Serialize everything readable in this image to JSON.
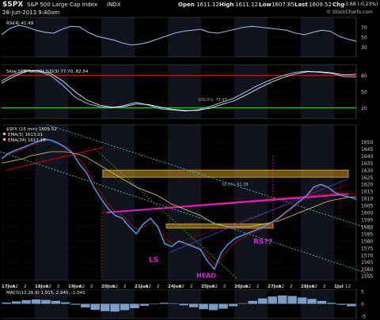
{
  "header": {
    "symbol": "$SPX",
    "name": "S&P 500 Large Cap Index",
    "exchange": "INDX",
    "date": "28-Jun-2013 9:40am",
    "open_label": "Open",
    "open": "1611.12",
    "high_label": "High",
    "high": "1611.12",
    "low_label": "Low",
    "low": "1607.85",
    "last_label": "Last",
    "last": "1609.52",
    "chg_label": "Chg",
    "chg": "-3.68 (-0.23%)",
    "credit": "© StockCharts.com"
  },
  "colors": {
    "background": "#000000",
    "grid": "#2a2a2a",
    "band": "#10131c",
    "price": "#4aa0ff",
    "indicator": "#8fb7e6",
    "ema": "#e8c46a",
    "red_line": "#e00000",
    "green_line": "#12d012",
    "magenta": "#e020e0",
    "cyan": "#30d8d8",
    "orange_box": "#c8961e",
    "annotation": "#e020e0"
  },
  "chart_data": [
    {
      "type": "line",
      "title": "RSI(4) 41.49",
      "series": [
        {
          "name": "RSI(4)",
          "values": [
            55,
            68,
            74,
            70,
            64,
            60,
            58,
            66,
            72,
            71,
            60,
            52,
            48,
            44,
            38,
            34,
            36,
            40,
            46,
            52,
            58,
            62,
            64,
            66,
            60,
            58,
            62,
            66,
            70,
            72,
            70,
            68,
            66,
            64,
            58,
            55,
            60,
            64,
            62,
            52,
            46,
            41.49
          ]
        }
      ],
      "ylim": [
        10,
        90
      ],
      "y_ticks": [
        70,
        50,
        30
      ],
      "x_labels": [
        "17Jun",
        "12",
        "2",
        "18Jun",
        "12",
        "2",
        "19Jun",
        "12",
        "2",
        "20Jun",
        "12",
        "2",
        "21Jun",
        "12",
        "2",
        "24Jun",
        "12",
        "2",
        "25Jun",
        "12",
        "2",
        "26Jun",
        "12",
        "2",
        "27Jun",
        "12",
        "2",
        "28Jun",
        "12",
        "2",
        "1Jul",
        "12"
      ]
    },
    {
      "type": "line",
      "title": "Slow STO %K(50) %D(3) 77.70, 82.54",
      "series": [
        {
          "name": "%K(50)",
          "values": [
            70,
            82,
            90,
            88,
            80,
            62,
            40,
            28,
            22,
            20,
            24,
            30,
            25,
            18,
            16,
            14,
            16,
            22,
            30,
            38,
            50,
            62,
            72,
            80,
            86,
            88,
            86,
            84,
            78,
            77.7
          ]
        },
        {
          "name": "%D(3)",
          "values": [
            66,
            78,
            88,
            89,
            84,
            70,
            50,
            34,
            25,
            21,
            22,
            27,
            26,
            21,
            17,
            15,
            15,
            19,
            26,
            33,
            44,
            56,
            67,
            76,
            83,
            87,
            87,
            85,
            81,
            82.54
          ]
        }
      ],
      "ylim": [
        0,
        100
      ],
      "y_ticks": [
        80,
        50,
        20
      ],
      "reference_lines": [
        80,
        20
      ],
      "annotations": [
        "100.0%: 73.97"
      ]
    },
    {
      "type": "line",
      "title": "$SPX (15 min) 1609.52",
      "legend": [
        "EMA(5) 1613.01",
        "EMA(34) 1611.16"
      ],
      "series": [
        {
          "name": "$SPX (15 min)",
          "values": [
            1638,
            1642,
            1644,
            1646,
            1648,
            1650,
            1652,
            1651,
            1649,
            1646,
            1642,
            1634,
            1628,
            1618,
            1610,
            1603,
            1598,
            1596,
            1590,
            1585,
            1592,
            1596,
            1590,
            1578,
            1576,
            1580,
            1578,
            1576,
            1574,
            1566,
            1560,
            1572,
            1578,
            1582,
            1584,
            1586,
            1588,
            1590,
            1593,
            1596,
            1600,
            1604,
            1608,
            1612,
            1618,
            1620,
            1618,
            1614,
            1612,
            1611,
            1609.52
          ]
        },
        {
          "name": "EMA(5)",
          "values": [
            1638,
            1641,
            1643,
            1645,
            1647,
            1649,
            1651,
            1651,
            1649,
            1647,
            1643,
            1637,
            1631,
            1622,
            1614,
            1606,
            1601,
            1598,
            1593,
            1588,
            1590,
            1593,
            1591,
            1582,
            1578,
            1579,
            1578,
            1577,
            1575,
            1569,
            1563,
            1568,
            1574,
            1579,
            1582,
            1585,
            1587,
            1589,
            1592,
            1595,
            1599,
            1603,
            1607,
            1611,
            1616,
            1619,
            1618,
            1615,
            1613,
            1613,
            1613.01
          ]
        },
        {
          "name": "EMA(34)",
          "values": [
            1635,
            1636,
            1637,
            1638,
            1640,
            1641,
            1642,
            1643,
            1643,
            1643,
            1642,
            1641,
            1639,
            1636,
            1633,
            1630,
            1627,
            1624,
            1621,
            1618,
            1616,
            1614,
            1612,
            1609,
            1606,
            1604,
            1602,
            1600,
            1598,
            1595,
            1592,
            1591,
            1590,
            1590,
            1590,
            1590,
            1591,
            1592,
            1593,
            1594,
            1596,
            1598,
            1600,
            1602,
            1604,
            1606,
            1608,
            1609,
            1610,
            1611,
            1611.16
          ]
        }
      ],
      "ylim": [
        1552,
        1662
      ],
      "y_ticks": [
        1650,
        1645,
        1640,
        1635,
        1630,
        1625,
        1620,
        1615,
        1610,
        1605,
        1600,
        1595,
        1590,
        1585,
        1580,
        1575,
        1570,
        1565,
        1560,
        1555
      ],
      "annotations": [
        "LS",
        "HEAD",
        "RS??",
        "50.0%: 61.38"
      ]
    },
    {
      "type": "bar",
      "title": "MACD(12,26,9) 1.915, 2.945, -1.041",
      "series": [
        {
          "name": "MACD histogram",
          "values": [
            0.5,
            1.0,
            1.5,
            1.8,
            1.6,
            1.2,
            0.6,
            -0.4,
            -1.5,
            -2.5,
            -3.0,
            -3.2,
            -2.6,
            -1.8,
            -0.8,
            -0.2,
            0.4,
            0.2,
            -0.6,
            -1.4,
            -2.2,
            -2.6,
            -2.0,
            -1.0,
            0.2,
            1.2,
            2.2,
            3.0,
            3.4,
            3.2,
            2.6,
            2.0,
            1.2,
            0.4,
            -0.4,
            -1.0
          ]
        }
      ],
      "ylim": [
        -6,
        6
      ],
      "y_ticks": [
        5,
        0,
        -5
      ]
    }
  ]
}
